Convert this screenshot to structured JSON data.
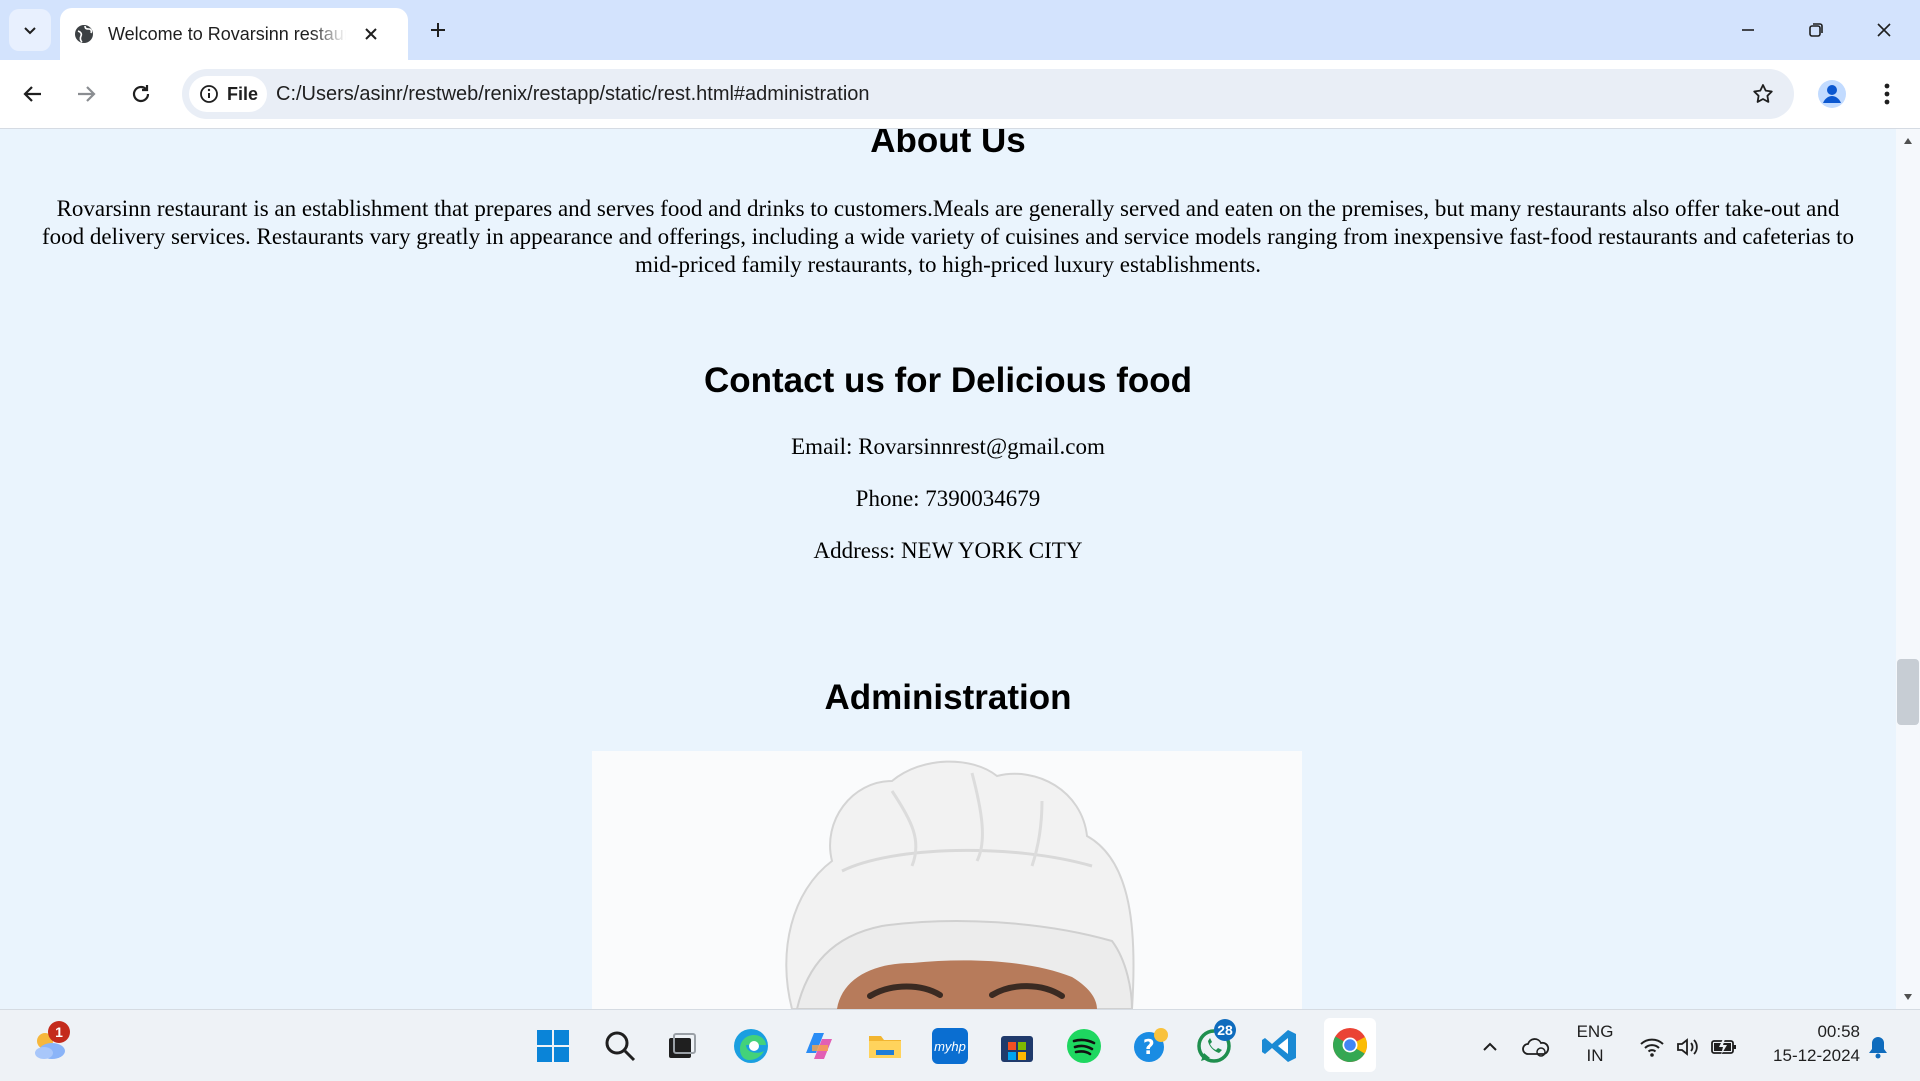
{
  "browser": {
    "tab_title": "Welcome to Rovarsinn restaurant",
    "omnibox_chip": "File",
    "url": "C:/Users/asinr/restweb/renix/restapp/static/rest.html#administration"
  },
  "about": {
    "heading": "About Us",
    "text": "Rovarsinn restaurant is an establishment that prepares and serves food and drinks to customers.Meals are generally served and eaten on the premises, but many restaurants also offer take-out and food delivery services. Restaurants vary greatly in appearance and offerings, including a wide variety of cuisines and service models ranging from inexpensive fast-food restaurants and cafeterias to mid-priced family restaurants, to high-priced luxury establishments."
  },
  "contact": {
    "heading": "Contact us for Delicious food",
    "email": "Email: Rovarsinnrest@gmail.com",
    "phone": "Phone: 7390034679",
    "address": "Address: NEW YORK CITY"
  },
  "administration": {
    "heading": "Administration"
  },
  "taskbar": {
    "weather_badge": "1",
    "whatsapp_badge": "28",
    "myhp_label": "myhp",
    "language_line1": "ENG",
    "language_line2": "IN",
    "time": "00:58",
    "date": "15-12-2024"
  },
  "colors": {
    "page_background": "#eaf4fd",
    "tabstrip": "#d3e3fd",
    "badge_red": "#c42b1c",
    "badge_blue": "#0f6cbd"
  }
}
